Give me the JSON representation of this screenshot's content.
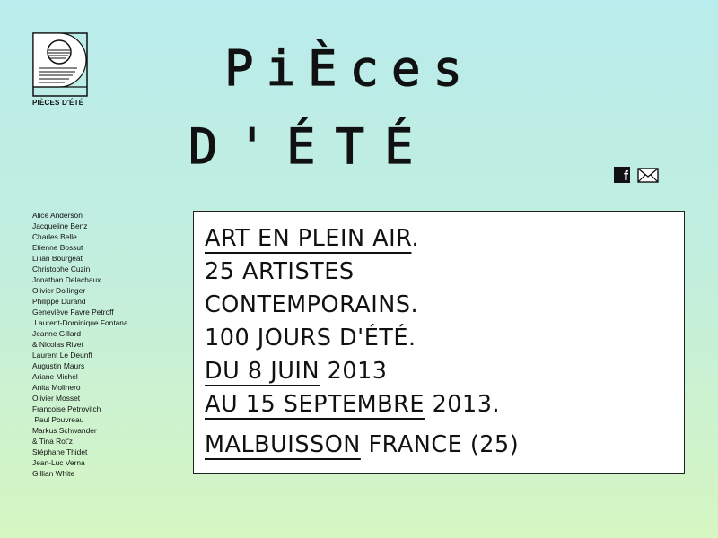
{
  "site": {
    "logo_label": "PIÈCES D'ÉTÉ",
    "title_line1": "PiÈces",
    "title_line2": "D'ÉTÉ"
  },
  "social": {
    "facebook_icon": "facebook-icon",
    "mail_icon": "mail-icon"
  },
  "artists": [
    "Alice Anderson",
    "Jacqueline Benz",
    "Charles Belle",
    "Etienne Bossut",
    "Lilian Bourgeat",
    "Christophe Cuzin",
    "Jonathan Delachaux",
    "Olivier Dollinger",
    "Philippe Durand",
    "Geneviève Favre Petroff",
    " Laurent-Dominique Fontana",
    "Jeanne Gillard",
    "& Nicolas Rivet",
    "Laurent Le Deunff",
    "Augustin Maurs",
    "Ariane Michel",
    "Anita Molinero",
    "Olivier Mosset",
    "Francoise Petrovitch",
    " Paul Pouvreau",
    "Markus Schwander",
    "& Tina Rot'z",
    "Stéphane Thidet",
    "Jean-Luc Verna",
    "Gillian White"
  ],
  "announcement": {
    "line1_ul": "ART EN PLEIN AIR",
    "line1_rest": ".",
    "line2": "25 ARTISTES",
    "line3": "CONTEMPORAINS.",
    "line4": "100 JOURS D'ÉTÉ.",
    "line5_ul": "DU 8 JUIN",
    "line5_rest": " 2013",
    "line6_ul": "AU 15 SEPTEMBRE",
    "line6_rest": " 2013.",
    "line7_ul": "MALBUISSON",
    "line7_rest": " FRANCE (25)"
  }
}
